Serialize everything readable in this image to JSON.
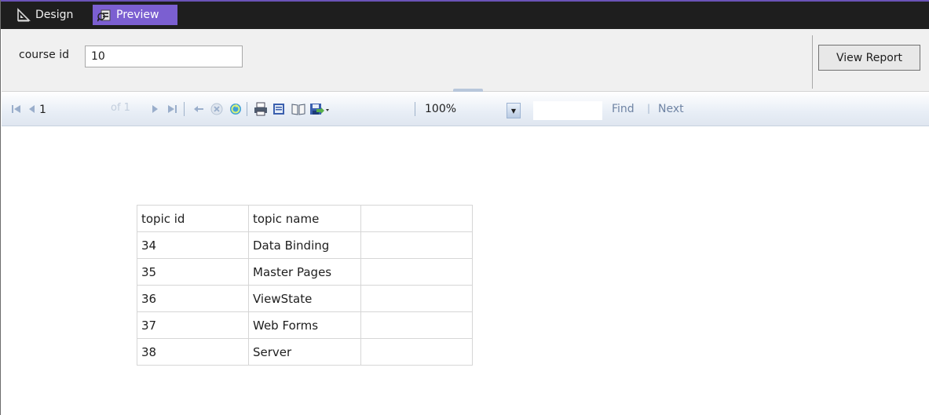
{
  "tabs": [
    {
      "label": "Design",
      "active": false,
      "icon": "design-ruler-icon"
    },
    {
      "label": "Preview",
      "active": true,
      "icon": "preview-report-icon"
    }
  ],
  "parameters": {
    "label": "course id",
    "value": "10",
    "view_report_label": "View Report"
  },
  "toolbar": {
    "page_current": "1",
    "page_of": "of 1",
    "zoom": "100%",
    "find_label": "Find",
    "find_sep": "|",
    "next_label": "Next"
  },
  "report": {
    "columns": [
      "topic id",
      "topic name",
      ""
    ],
    "rows": [
      [
        "34",
        "Data Binding",
        ""
      ],
      [
        "35",
        "Master Pages",
        ""
      ],
      [
        "36",
        "ViewState",
        ""
      ],
      [
        "37",
        "Web Forms",
        ""
      ],
      [
        "38",
        "Server",
        ""
      ]
    ]
  },
  "colors": {
    "accent": "#7b5fd1",
    "titlebar": "#1e1e1e",
    "toolbar_icon": "#7d93b3"
  }
}
